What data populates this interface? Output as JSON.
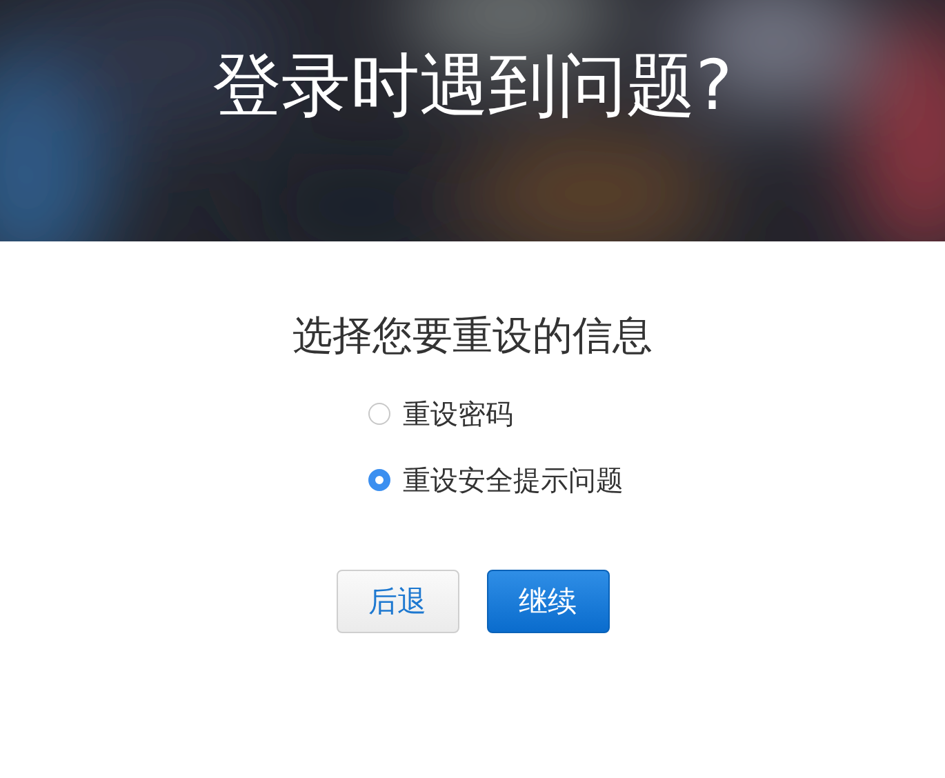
{
  "header": {
    "title": "登录时遇到问题?"
  },
  "prompt": "选择您要重设的信息",
  "options": [
    {
      "label": "重设密码",
      "selected": false
    },
    {
      "label": "重设安全提示问题",
      "selected": true
    }
  ],
  "buttons": [
    {
      "label": "后退",
      "kind": "secondary"
    },
    {
      "label": "继续",
      "kind": "primary"
    }
  ]
}
